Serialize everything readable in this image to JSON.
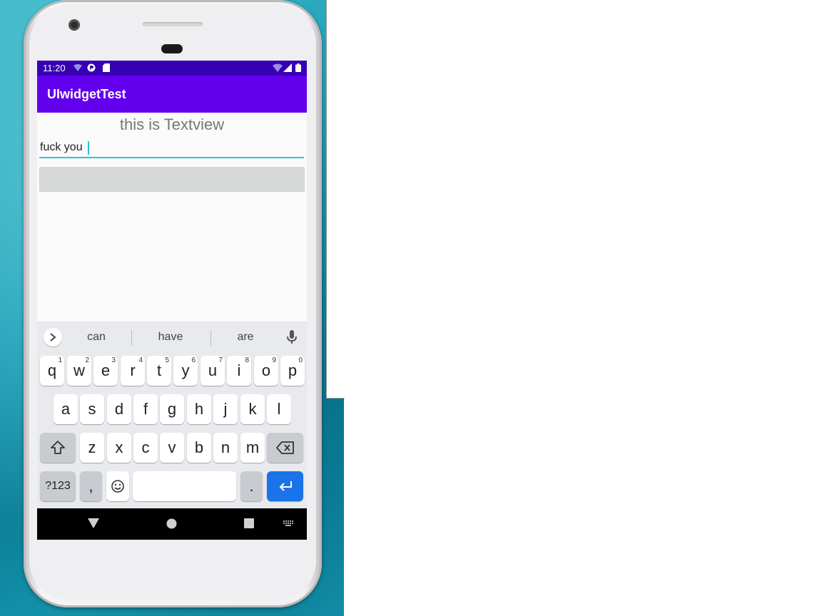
{
  "status_bar": {
    "time": "11:20"
  },
  "app_bar": {
    "title": "UIwidgetTest"
  },
  "content": {
    "textview_text": "this is Textview",
    "edit_text_value": "fuck you"
  },
  "keyboard": {
    "suggestions": [
      "can",
      "have",
      "are"
    ],
    "row1": [
      {
        "key": "q",
        "hint": "1"
      },
      {
        "key": "w",
        "hint": "2"
      },
      {
        "key": "e",
        "hint": "3"
      },
      {
        "key": "r",
        "hint": "4"
      },
      {
        "key": "t",
        "hint": "5"
      },
      {
        "key": "y",
        "hint": "6"
      },
      {
        "key": "u",
        "hint": "7"
      },
      {
        "key": "i",
        "hint": "8"
      },
      {
        "key": "o",
        "hint": "9"
      },
      {
        "key": "p",
        "hint": "0"
      }
    ],
    "row2": [
      "a",
      "s",
      "d",
      "f",
      "g",
      "h",
      "j",
      "k",
      "l"
    ],
    "row3": [
      "z",
      "x",
      "c",
      "v",
      "b",
      "n",
      "m"
    ],
    "symbols_label": "?123",
    "comma_label": ",",
    "period_label": "."
  },
  "colors": {
    "status_bar": "#3700b3",
    "app_bar": "#6200ee",
    "edit_underline": "#26c6da",
    "enter_key": "#1a73e8"
  },
  "icons": [
    "wifi-icon",
    "signal-icon",
    "battery-icon",
    "sd-card-icon",
    "notification-icon",
    "chevron-right-icon",
    "microphone-icon",
    "shift-icon",
    "backspace-icon",
    "emoji-icon",
    "enter-icon",
    "nav-back-icon",
    "nav-home-icon",
    "nav-recents-icon",
    "keyboard-switch-icon"
  ]
}
